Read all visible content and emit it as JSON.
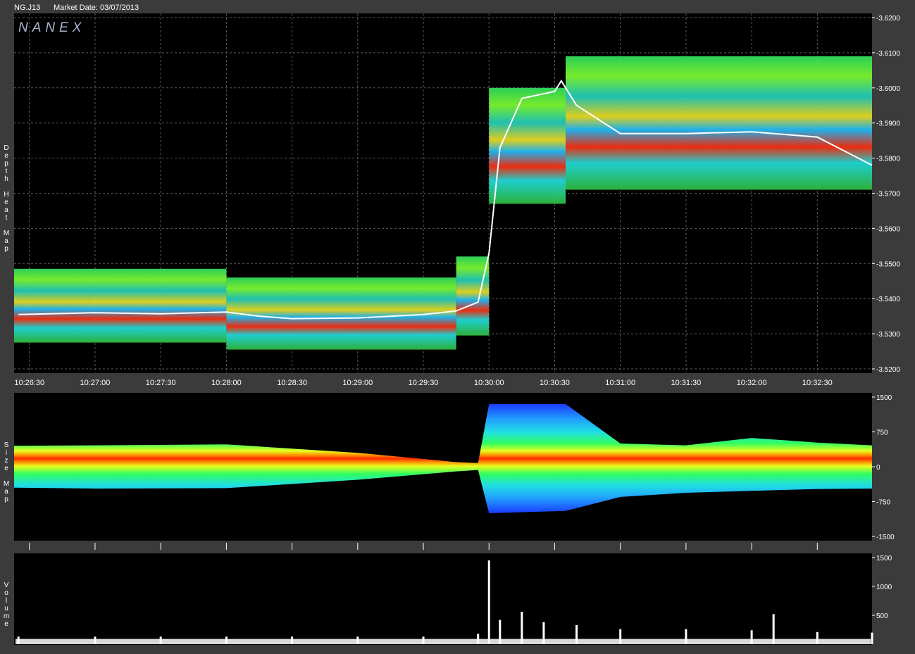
{
  "header": {
    "symbol": "NG.J13",
    "market_date": "Market Date: 03/07/2013"
  },
  "brand": "NANEX",
  "colors": {
    "background": "#3b3b3b",
    "panel": "#000000",
    "grid": "#5a5a5a",
    "trade_line": "#ffffff",
    "volume_bar": "#ffffff"
  },
  "chart_data": [
    {
      "type": "heatmap",
      "panel": "depth-heat-map",
      "ylabel": "Depth Heat Map",
      "y_tick_labels": [
        "3.6200",
        "3.6100",
        "3.6000",
        "3.5900",
        "3.5800",
        "3.5700",
        "3.5600",
        "3.5500",
        "3.5400",
        "3.5300",
        "3.5200"
      ],
      "ylim": [
        3.52,
        3.62
      ],
      "x_tick_labels": [
        "10:26:30",
        "10:27:00",
        "10:27:30",
        "10:28:00",
        "10:28:30",
        "10:29:00",
        "10:29:30",
        "10:30:00",
        "10:30:30",
        "10:31:00",
        "10:31:30",
        "10:32:00",
        "10:32:30"
      ],
      "x_range": [
        "10:26:23",
        "10:32:55"
      ],
      "trade_price_series": {
        "x": [
          "10:26:25",
          "10:27:00",
          "10:27:30",
          "10:28:00",
          "10:28:15",
          "10:28:30",
          "10:29:00",
          "10:29:30",
          "10:29:45",
          "10:29:55",
          "10:30:00",
          "10:30:05",
          "10:30:15",
          "10:30:30",
          "10:30:33",
          "10:30:40",
          "10:31:00",
          "10:31:30",
          "10:32:00",
          "10:32:30",
          "10:32:55"
        ],
        "y": [
          3.5355,
          3.536,
          3.5357,
          3.5362,
          3.535,
          3.5343,
          3.5345,
          3.5355,
          3.5365,
          3.539,
          3.553,
          3.583,
          3.597,
          3.599,
          3.602,
          3.595,
          3.587,
          3.587,
          3.5875,
          3.586,
          3.578
        ]
      },
      "depth_bands": [
        {
          "x": [
            "10:26:23",
            "10:28:00"
          ],
          "y": [
            3.5275,
            3.5485
          ]
        },
        {
          "x": [
            "10:28:00",
            "10:29:45"
          ],
          "y": [
            3.5255,
            3.546
          ]
        },
        {
          "x": [
            "10:29:45",
            "10:30:00"
          ],
          "y": [
            3.5295,
            3.552
          ]
        },
        {
          "x": [
            "10:30:00",
            "10:30:35"
          ],
          "y": [
            3.567,
            3.6
          ]
        },
        {
          "x": [
            "10:30:35",
            "10:32:55"
          ],
          "y": [
            3.571,
            3.609
          ]
        }
      ]
    },
    {
      "type": "heatmap",
      "panel": "size-map",
      "ylabel": "Size Map",
      "y_tick_labels": [
        "1500",
        "750",
        "0",
        "-750",
        "-1500"
      ],
      "ylim": [
        -1500,
        1500
      ],
      "envelope": {
        "x": [
          "10:26:23",
          "10:27:00",
          "10:28:00",
          "10:29:00",
          "10:29:45",
          "10:29:55",
          "10:30:00",
          "10:30:35",
          "10:31:00",
          "10:31:30",
          "10:32:00",
          "10:32:30",
          "10:32:55"
        ],
        "upper": [
          450,
          460,
          480,
          300,
          100,
          80,
          1350,
          1350,
          500,
          460,
          620,
          520,
          460
        ],
        "lower": [
          -450,
          -470,
          -460,
          -280,
          -100,
          -70,
          -1000,
          -950,
          -650,
          -560,
          -520,
          -480,
          -470
        ]
      }
    },
    {
      "type": "bar",
      "panel": "volume",
      "ylabel": "Volume",
      "y_tick_labels": [
        "1500",
        "1000",
        "500"
      ],
      "ylim": [
        0,
        1500
      ],
      "x": [
        "10:26:25",
        "10:27:00",
        "10:27:30",
        "10:28:00",
        "10:28:30",
        "10:29:00",
        "10:29:30",
        "10:29:55",
        "10:30:00",
        "10:30:05",
        "10:30:15",
        "10:30:25",
        "10:30:40",
        "10:31:00",
        "10:31:30",
        "10:32:00",
        "10:32:10",
        "10:32:30",
        "10:32:55"
      ],
      "values": [
        130,
        130,
        130,
        130,
        130,
        130,
        130,
        180,
        1450,
        420,
        560,
        380,
        330,
        260,
        260,
        240,
        520,
        210,
        200
      ]
    }
  ]
}
